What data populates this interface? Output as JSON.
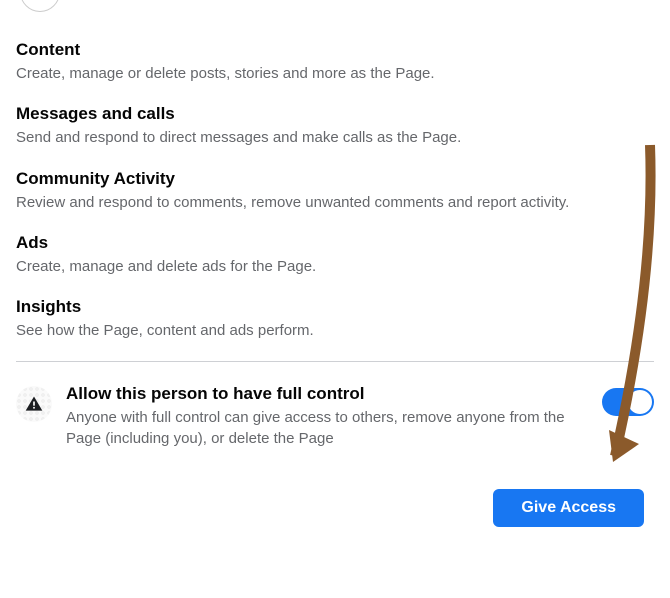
{
  "sections": [
    {
      "title": "Content",
      "desc": "Create, manage or delete posts, stories and more as the Page."
    },
    {
      "title": "Messages and calls",
      "desc": "Send and respond to direct messages and make calls as the Page."
    },
    {
      "title": "Community Activity",
      "desc": "Review and respond to comments, remove unwanted comments and report activity."
    },
    {
      "title": "Ads",
      "desc": "Create, manage and delete ads for the Page."
    },
    {
      "title": "Insights",
      "desc": "See how the Page, content and ads perform."
    }
  ],
  "full_control": {
    "title": "Allow this person to have full control",
    "desc": "Anyone with full control can give access to others, remove anyone from the Page (including you), or delete the Page"
  },
  "footer": {
    "give_access_label": "Give Access"
  }
}
